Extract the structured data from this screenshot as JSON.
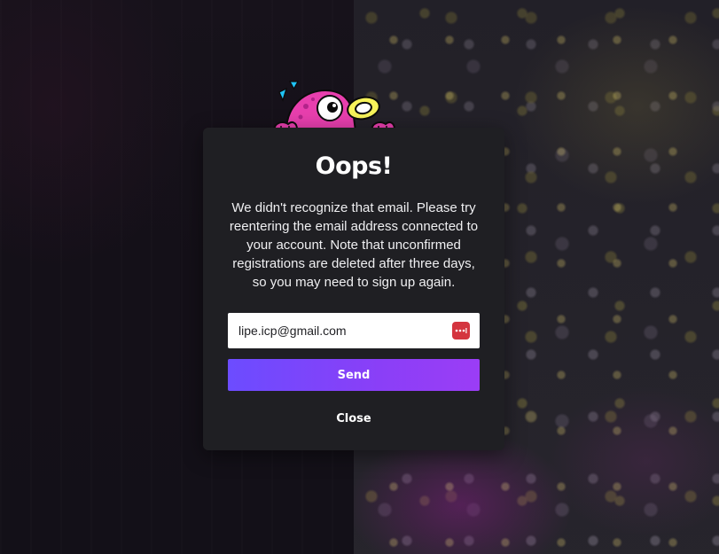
{
  "modal": {
    "title": "Oops!",
    "message": "We didn't recognize that email. Please try reentering the email address connected to your account. Note that unconfirmed registrations are deleted after three days, so you may need to sign up again.",
    "email_value": "lipe.icp@gmail.com",
    "send_label": "Send",
    "close_label": "Close"
  },
  "icons": {
    "mascot": "pink-glitch-mascot",
    "password_manager": "password-manager-icon"
  },
  "colors": {
    "modal_bg": "#1f1f23",
    "send_gradient_start": "#6c4cff",
    "send_gradient_end": "#9b3df6",
    "mascot_pink": "#e83fae",
    "mascot_yellow": "#f7f35a",
    "sparkle_blue": "#1fc3f5",
    "pw_icon_red": "#d4353f"
  }
}
